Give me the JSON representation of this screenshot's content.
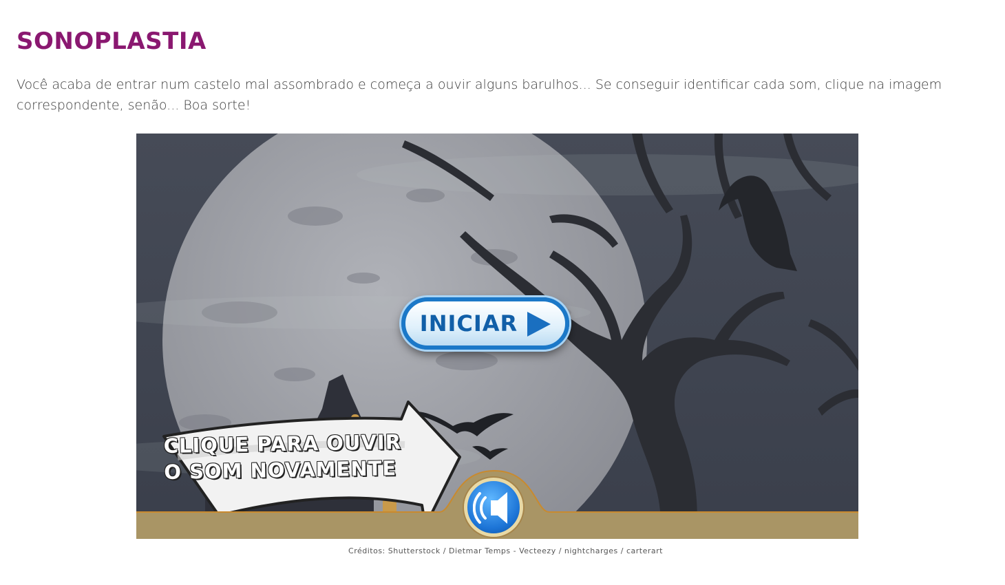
{
  "page": {
    "title": "SONOPLASTIA",
    "intro": "Você acaba de entrar num castelo mal assombrado e começa a ouvir alguns barulhos... Se conseguir identificar cada som, clique na imagem correspondente, senão... Boa sorte!",
    "credits": "Créditos: Shutterstock / Dietmar Temps - Vecteezy / nightcharges / carterart"
  },
  "game": {
    "start_label": "INICIAR",
    "hint_line1": "CLIQUE PARA OUVIR",
    "hint_line2": "O SOM NOVAMENTE",
    "icons": [
      "play-icon",
      "speaker-icon",
      "arrow-icon"
    ]
  },
  "colors": {
    "title": "#8a1870",
    "text": "#3a3a3a",
    "sky": "#3d4350",
    "moon": "#9a9ca3",
    "silhouette": "#2b2d33",
    "bar": "#a99565",
    "button_border": "#1b78c8",
    "button_text": "#115fa8"
  }
}
